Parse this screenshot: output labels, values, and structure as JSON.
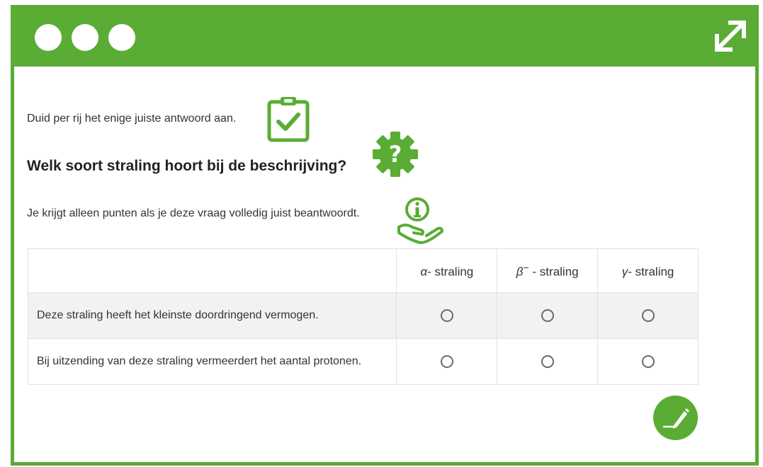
{
  "window": {
    "buttons": [
      "close",
      "minimize",
      "maximize"
    ],
    "expand_icon": "expand-arrows-icon",
    "accent_color": "#5aac34"
  },
  "content": {
    "instruction": "Duid per rij het enige juiste antwoord aan.",
    "question": "Welk soort straling hoort bij de beschrijving?",
    "note": "Je krijgt alleen punten als je deze vraag volledig juist beantwoordt.",
    "icons": [
      "clipboard-check-icon",
      "gear-question-icon",
      "hand-info-icon",
      "pencil-icon"
    ]
  },
  "table": {
    "columns": [
      {
        "symbol": "α",
        "sup": "",
        "suffix": "- straling"
      },
      {
        "symbol": "β",
        "sup": "−",
        "suffix": " - straling"
      },
      {
        "symbol": "γ",
        "sup": "",
        "suffix": "- straling"
      }
    ],
    "rows": [
      {
        "statement": "Deze straling heeft het kleinste doordringend vermogen.",
        "selected": null
      },
      {
        "statement": "Bij uitzending van deze straling vermeerdert het aantal protonen.",
        "selected": null
      }
    ]
  }
}
